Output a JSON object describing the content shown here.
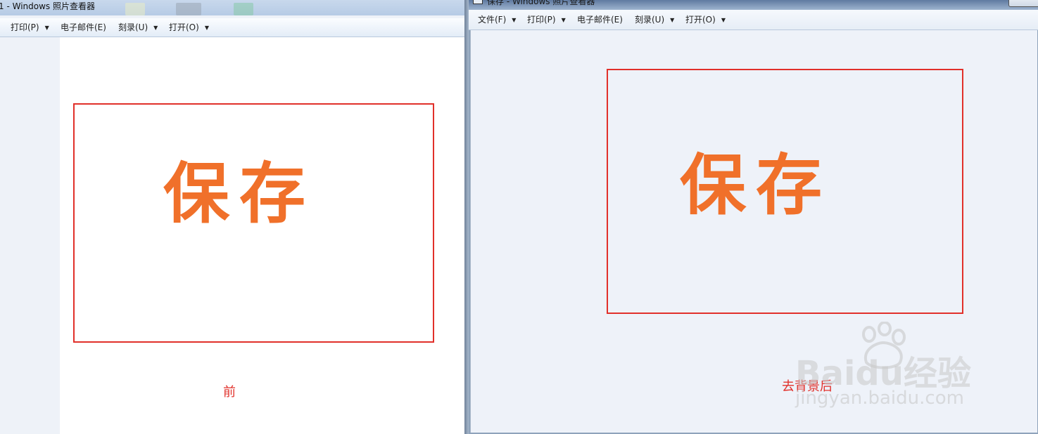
{
  "left_window": {
    "title": "1 - Windows 照片查看器",
    "menu": [
      {
        "label": "打印(P)",
        "dropdown": true
      },
      {
        "label": "电子邮件(E)",
        "dropdown": false
      },
      {
        "label": "刻录(U)",
        "dropdown": true
      },
      {
        "label": "打开(O)",
        "dropdown": true
      }
    ],
    "image_text": "保存",
    "caption": "前"
  },
  "right_window": {
    "title": "保存 - Windows 照片查看器",
    "menu": [
      {
        "label": "文件(F)",
        "dropdown": true
      },
      {
        "label": "打印(P)",
        "dropdown": true
      },
      {
        "label": "电子邮件(E)",
        "dropdown": false
      },
      {
        "label": "刻录(U)",
        "dropdown": true
      },
      {
        "label": "打开(O)",
        "dropdown": true
      }
    ],
    "image_text": "保存",
    "caption": "去背景后"
  },
  "watermark": {
    "logo": "Baidu经验",
    "url": "jingyan.baidu.com"
  },
  "icons": {
    "dropdown_arrow": "▼",
    "paw": "baidu-paw-icon"
  },
  "colors": {
    "accent_orange": "#f0702a",
    "frame_red": "#e1302a",
    "caption_red": "#e1302a"
  }
}
